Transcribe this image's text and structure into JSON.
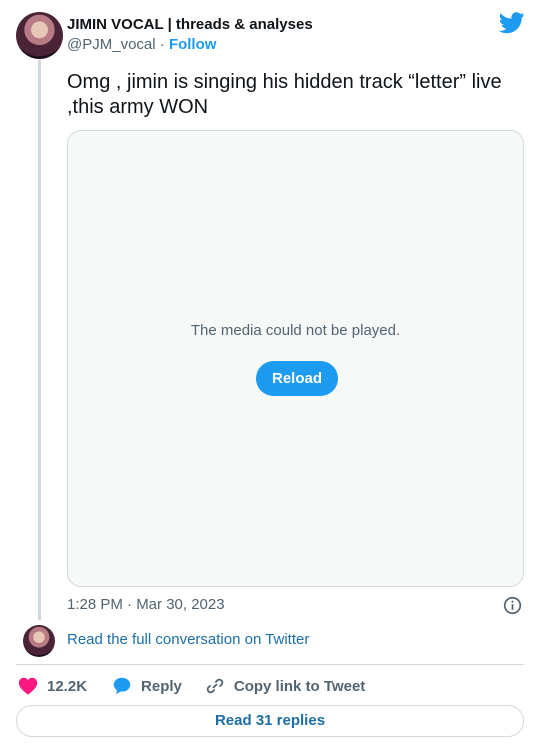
{
  "author": {
    "name": "JIMIN VOCAL | threads & analyses",
    "handle": "@PJM_vocal",
    "separator": "·",
    "follow_label": "Follow"
  },
  "tweet": {
    "text": "Omg , jimin is singing his hidden track “letter” live ,this army WON",
    "timestamp": "1:28 PM · Mar 30, 2023"
  },
  "media": {
    "error_message": "The media could not be played.",
    "reload_label": "Reload"
  },
  "conversation_link": "Read the full conversation on Twitter",
  "actions": {
    "likes": "12.2K",
    "reply_label": "Reply",
    "copy_label": "Copy link to Tweet"
  },
  "read_replies_label": "Read 31 replies",
  "colors": {
    "accent": "#1d9bf0",
    "like": "#f91880",
    "link": "#1d6fa5",
    "muted": "#536471",
    "border": "#cfd9de"
  },
  "icons": [
    "twitter-bird-icon",
    "info-icon",
    "heart-icon",
    "reply-bubble-icon",
    "link-icon"
  ]
}
